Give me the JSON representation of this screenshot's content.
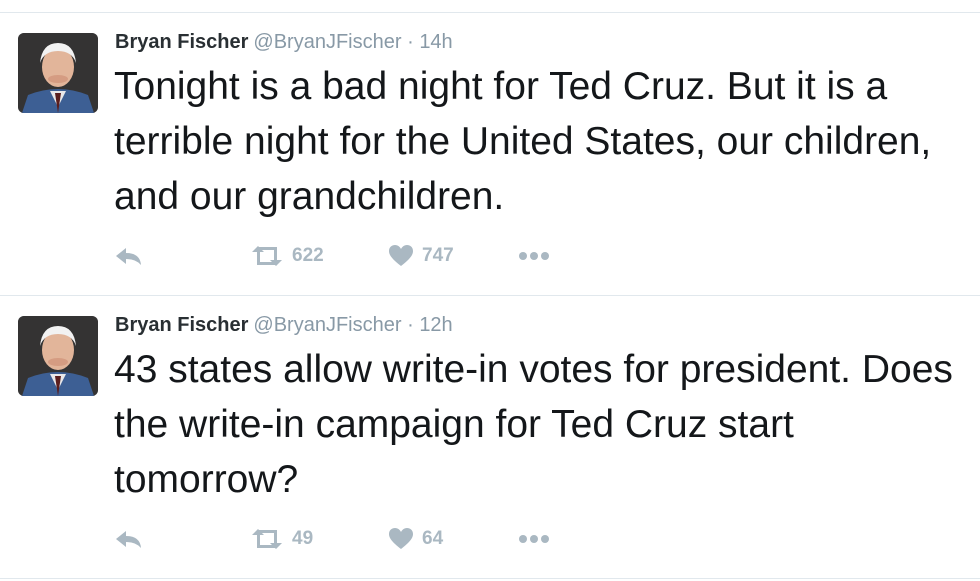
{
  "colors": {
    "text": "#14171a",
    "name": "#292f33",
    "meta": "#8899a6",
    "icon": "#aab8c2",
    "divider": "#e1e8ed"
  },
  "tweets": [
    {
      "author": "Bryan Fischer",
      "handle": "@BryanJFischer",
      "separator": "·",
      "time": "14h",
      "text": "Tonight is a bad night for Ted Cruz. But it is a terrible night for the United States, our children, and our grandchildren.",
      "retweets": "622",
      "likes": "747"
    },
    {
      "author": "Bryan Fischer",
      "handle": "@BryanJFischer",
      "separator": "·",
      "time": "12h",
      "text": "43 states allow write-in votes for president. Does the write-in campaign for Ted Cruz start tomorrow?",
      "retweets": "49",
      "likes": "64"
    }
  ]
}
